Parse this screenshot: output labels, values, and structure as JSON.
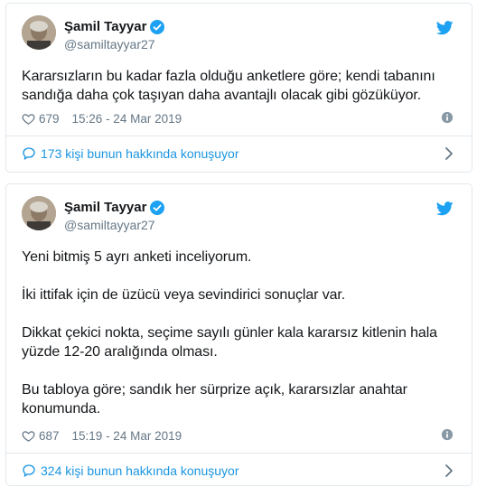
{
  "tweets": [
    {
      "author_name": "Şamil Tayyar",
      "handle": "@samiltayyar27",
      "paragraphs": [
        "Kararsızların bu kadar fazla olduğu anketlere göre; kendi tabanını sandığa daha çok taşıyan daha avantajlı olacak gibi gözüküyor."
      ],
      "likes": "679",
      "timestamp": "15:26 - 24 Mar 2019",
      "conversation_label": "173 kişi bunun hakkında konuşuyor"
    },
    {
      "author_name": "Şamil Tayyar",
      "handle": "@samiltayyar27",
      "paragraphs": [
        "Yeni bitmiş 5 ayrı anketi inceliyorum.",
        "İki ittifak için de üzücü veya sevindirici sonuçlar var.",
        "Dikkat çekici nokta, seçime sayılı günler kala kararsız kitlenin hala yüzde 12-20 aralığında olması.",
        "Bu tabloya göre; sandık her sürprize açık, kararsızlar anahtar konumunda."
      ],
      "likes": "687",
      "timestamp": "15:19 - 24 Mar 2019",
      "conversation_label": "324 kişi bunun hakkında konuşuyor"
    }
  ],
  "colors": {
    "accent": "#1da1f2",
    "link": "#1b95e0",
    "muted": "#657786",
    "border": "#e1e8ed",
    "text": "#14171a"
  },
  "icons": [
    "verified-badge-icon",
    "twitter-bird-icon",
    "heart-icon",
    "info-icon",
    "reply-bubble-icon",
    "chevron-right-icon"
  ]
}
